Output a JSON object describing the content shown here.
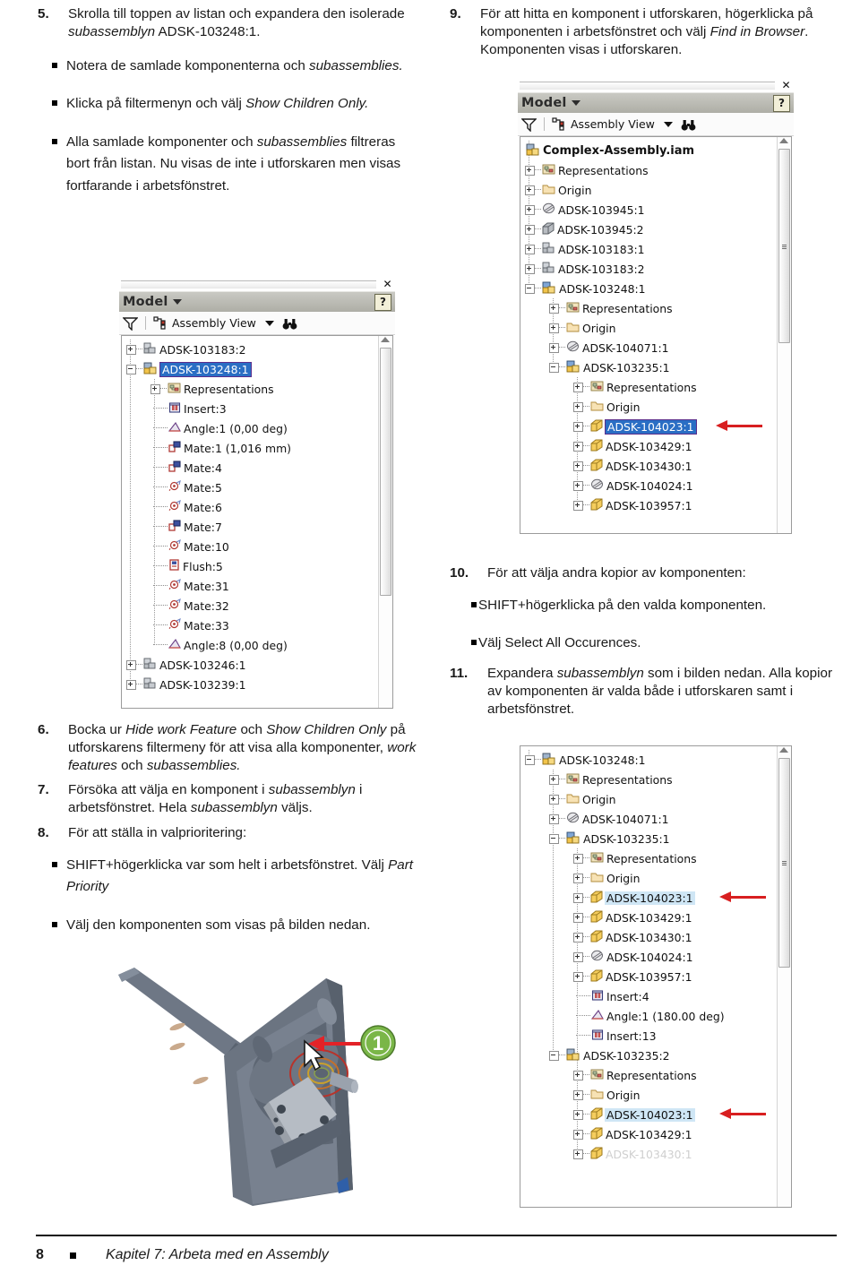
{
  "document": {
    "footer": {
      "page_number": "8",
      "bullet": "square-bullet",
      "text": "Kapitel 7: Arbeta med en Assembly"
    }
  },
  "left_column": {
    "step5": {
      "number": "5.",
      "text_a": "Skrolla till toppen av listan och expandera den isolerade ",
      "text_b": "subassemblyn",
      "text_c": " ADSK-103248:1.",
      "bullets": [
        {
          "a": "Notera de samlade komponenterna och ",
          "b": "subassemblies.",
          "c": ""
        },
        {
          "a": "Klicka på filtermenyn och välj ",
          "b": "Show Children Only.",
          "c": ""
        },
        {
          "a": "Alla samlade komponenter och ",
          "b": "subassemblies",
          "c": " filtreras bort från listan. Nu visas de inte i utforskaren men visas fortfarande i arbetsfönstret."
        }
      ]
    },
    "step6": {
      "number": "6.",
      "t1": "Bocka ur ",
      "i1": "Hide work Feature",
      "t2": " och ",
      "i2": "Show Children Only",
      "t3": " på utforskarens filtermeny för att visa alla komponenter, ",
      "i3": "work features",
      "t4": " och ",
      "i4": "subassemblies."
    },
    "step7": {
      "number": "7.",
      "t1": "Försöka att välja en komponent i ",
      "i1": "subassemblyn",
      "t2": " i arbetsfönstret. Hela ",
      "i2": "subassemblyn",
      "t3": " väljs."
    },
    "step8": {
      "number": "8.",
      "text": "För att ställa in valprioritering:",
      "bullets": [
        {
          "a": "SHIFT+högerklicka var som helt i arbetsfönstret. Välj ",
          "b": "Part Priority",
          "c": ""
        },
        {
          "a": "Välj den komponenten som visas på bilden nedan.",
          "b": "",
          "c": ""
        }
      ]
    },
    "cad_image": {
      "callout_label": "1",
      "callout_color": "#7ab648",
      "arrow_color": "#e32227",
      "alt": "3D CAD assembly view with cursor and callout"
    }
  },
  "right_column": {
    "step9": {
      "number": "9.",
      "t1": "För att hitta en komponent i utforskaren, högerklicka på komponenten i arbetsfönstret och välj ",
      "i1": "Find in Browser",
      "t2": ". Komponenten visas i utforskaren."
    },
    "step10": {
      "number": "10.",
      "text": "För att välja andra kopior av komponenten:",
      "bullets": [
        {
          "a": "SHIFT+högerklicka på den valda komponenten.",
          "b": "",
          "c": ""
        },
        {
          "a": "Välj Select All Occurences.",
          "b": "",
          "c": ""
        }
      ]
    },
    "step11": {
      "number": "11.",
      "t1": "Expandera ",
      "i1": "subassemblyn",
      "t2": " som i bilden nedan. Alla kopior av komponenten är valda både i utforskaren samt i arbetsfönstret."
    }
  },
  "browser_left": {
    "title": "Model",
    "close_icon": "close-icon",
    "help_icon": "help-icon",
    "filter_icon": "filter-icon",
    "view_icon": "assembly-view-icon",
    "view_label": "Assembly View",
    "find_icon": "binoculars-icon",
    "tree": [
      {
        "label": "ADSK-103183:2",
        "indent": 0,
        "toggle": "plus",
        "icon": "part-grey",
        "state": "normal"
      },
      {
        "label": "ADSK-103248:1",
        "indent": 0,
        "toggle": "minus",
        "icon": "assembly-yellow",
        "state": "selected"
      },
      {
        "label": "Representations",
        "indent": 1,
        "toggle": "plus",
        "icon": "representations",
        "state": "normal"
      },
      {
        "label": "Insert:3",
        "indent": 1,
        "toggle": "none",
        "icon": "insert-constraint",
        "state": "normal"
      },
      {
        "label": "Angle:1 (0,00 deg)",
        "indent": 1,
        "toggle": "none",
        "icon": "angle-constraint",
        "state": "normal"
      },
      {
        "label": "Mate:1 (1,016 mm)",
        "indent": 1,
        "toggle": "none",
        "icon": "mate-constraint",
        "state": "normal"
      },
      {
        "label": "Mate:4",
        "indent": 1,
        "toggle": "none",
        "icon": "mate-constraint",
        "state": "normal"
      },
      {
        "label": "Mate:5",
        "indent": 1,
        "toggle": "none",
        "icon": "mate-axis-constraint",
        "state": "normal"
      },
      {
        "label": "Mate:6",
        "indent": 1,
        "toggle": "none",
        "icon": "mate-axis-constraint",
        "state": "normal"
      },
      {
        "label": "Mate:7",
        "indent": 1,
        "toggle": "none",
        "icon": "mate-constraint",
        "state": "normal"
      },
      {
        "label": "Mate:10",
        "indent": 1,
        "toggle": "none",
        "icon": "mate-axis-constraint",
        "state": "normal"
      },
      {
        "label": "Flush:5",
        "indent": 1,
        "toggle": "none",
        "icon": "flush-constraint",
        "state": "normal"
      },
      {
        "label": "Mate:31",
        "indent": 1,
        "toggle": "none",
        "icon": "mate-axis-constraint",
        "state": "normal"
      },
      {
        "label": "Mate:32",
        "indent": 1,
        "toggle": "none",
        "icon": "mate-axis-constraint",
        "state": "normal"
      },
      {
        "label": "Mate:33",
        "indent": 1,
        "toggle": "none",
        "icon": "mate-axis-constraint",
        "state": "normal"
      },
      {
        "label": "Angle:8 (0,00 deg)",
        "indent": 1,
        "toggle": "none",
        "icon": "angle-constraint",
        "state": "normal"
      },
      {
        "label": "ADSK-103246:1",
        "indent": 0,
        "toggle": "plus",
        "icon": "part-grey",
        "state": "normal"
      },
      {
        "label": "ADSK-103239:1",
        "indent": 0,
        "toggle": "plus",
        "icon": "part-grey",
        "state": "normal"
      }
    ]
  },
  "browser_right_top": {
    "title": "Model",
    "close_icon": "close-icon",
    "help_icon": "help-icon",
    "filter_icon": "filter-icon",
    "view_icon": "assembly-view-icon",
    "view_label": "Assembly View",
    "find_icon": "binoculars-icon",
    "tree": [
      {
        "label": "Complex-Assembly.iam",
        "indent": 0,
        "toggle": "none",
        "icon": "assembly-yellow",
        "state": "root"
      },
      {
        "label": "Representations",
        "indent": 0,
        "toggle": "plus",
        "icon": "representations",
        "state": "normal"
      },
      {
        "label": "Origin",
        "indent": 0,
        "toggle": "plus",
        "icon": "folder",
        "state": "normal"
      },
      {
        "label": "ADSK-103945:1",
        "indent": 0,
        "toggle": "plus",
        "icon": "weldment",
        "state": "normal"
      },
      {
        "label": "ADSK-103945:2",
        "indent": 0,
        "toggle": "plus",
        "icon": "box-grey",
        "state": "normal"
      },
      {
        "label": "ADSK-103183:1",
        "indent": 0,
        "toggle": "plus",
        "icon": "part-grey",
        "state": "normal"
      },
      {
        "label": "ADSK-103183:2",
        "indent": 0,
        "toggle": "plus",
        "icon": "part-grey",
        "state": "normal"
      },
      {
        "label": "ADSK-103248:1",
        "indent": 0,
        "toggle": "minus",
        "icon": "assembly-blue",
        "state": "normal"
      },
      {
        "label": "Representations",
        "indent": 1,
        "toggle": "plus",
        "icon": "representations",
        "state": "normal"
      },
      {
        "label": "Origin",
        "indent": 1,
        "toggle": "plus",
        "icon": "folder",
        "state": "normal"
      },
      {
        "label": "ADSK-104071:1",
        "indent": 1,
        "toggle": "plus",
        "icon": "weldment",
        "state": "normal"
      },
      {
        "label": "ADSK-103235:1",
        "indent": 1,
        "toggle": "minus",
        "icon": "assembly-blue",
        "state": "normal"
      },
      {
        "label": "Representations",
        "indent": 2,
        "toggle": "plus",
        "icon": "representations",
        "state": "normal"
      },
      {
        "label": "Origin",
        "indent": 2,
        "toggle": "plus",
        "icon": "folder",
        "state": "normal"
      },
      {
        "label": "ADSK-104023:1",
        "indent": 2,
        "toggle": "plus",
        "icon": "box-yellow",
        "state": "selected"
      },
      {
        "label": "ADSK-103429:1",
        "indent": 2,
        "toggle": "plus",
        "icon": "box-yellow",
        "state": "normal"
      },
      {
        "label": "ADSK-103430:1",
        "indent": 2,
        "toggle": "plus",
        "icon": "box-yellow",
        "state": "normal"
      },
      {
        "label": "ADSK-104024:1",
        "indent": 2,
        "toggle": "plus",
        "icon": "weldment",
        "state": "normal"
      },
      {
        "label": "ADSK-103957:1",
        "indent": 2,
        "toggle": "plus",
        "icon": "box-yellow",
        "state": "normal"
      }
    ]
  },
  "browser_right_bottom": {
    "tree": [
      {
        "label": "ADSK-103248:1",
        "indent": 0,
        "toggle": "minus",
        "icon": "assembly-yellow",
        "state": "normal"
      },
      {
        "label": "Representations",
        "indent": 1,
        "toggle": "plus",
        "icon": "representations",
        "state": "normal"
      },
      {
        "label": "Origin",
        "indent": 1,
        "toggle": "plus",
        "icon": "folder",
        "state": "normal"
      },
      {
        "label": "ADSK-104071:1",
        "indent": 1,
        "toggle": "plus",
        "icon": "weldment",
        "state": "normal"
      },
      {
        "label": "ADSK-103235:1",
        "indent": 1,
        "toggle": "minus",
        "icon": "assembly-blue",
        "state": "normal"
      },
      {
        "label": "Representations",
        "indent": 2,
        "toggle": "plus",
        "icon": "representations",
        "state": "normal"
      },
      {
        "label": "Origin",
        "indent": 2,
        "toggle": "plus",
        "icon": "folder",
        "state": "normal"
      },
      {
        "label": "ADSK-104023:1",
        "indent": 2,
        "toggle": "plus",
        "icon": "box-yellow",
        "state": "highlighted"
      },
      {
        "label": "ADSK-103429:1",
        "indent": 2,
        "toggle": "plus",
        "icon": "box-yellow",
        "state": "normal"
      },
      {
        "label": "ADSK-103430:1",
        "indent": 2,
        "toggle": "plus",
        "icon": "box-yellow",
        "state": "normal"
      },
      {
        "label": "ADSK-104024:1",
        "indent": 2,
        "toggle": "plus",
        "icon": "weldment",
        "state": "normal"
      },
      {
        "label": "ADSK-103957:1",
        "indent": 2,
        "toggle": "plus",
        "icon": "box-yellow",
        "state": "normal"
      },
      {
        "label": "Insert:4",
        "indent": 2,
        "toggle": "none",
        "icon": "insert-constraint",
        "state": "normal"
      },
      {
        "label": "Angle:1 (180.00 deg)",
        "indent": 2,
        "toggle": "none",
        "icon": "angle-constraint",
        "state": "normal"
      },
      {
        "label": "Insert:13",
        "indent": 2,
        "toggle": "none",
        "icon": "insert-constraint",
        "state": "normal"
      },
      {
        "label": "ADSK-103235:2",
        "indent": 1,
        "toggle": "minus",
        "icon": "assembly-yellow",
        "state": "normal"
      },
      {
        "label": "Representations",
        "indent": 2,
        "toggle": "plus",
        "icon": "representations",
        "state": "normal"
      },
      {
        "label": "Origin",
        "indent": 2,
        "toggle": "plus",
        "icon": "folder",
        "state": "normal"
      },
      {
        "label": "ADSK-104023:1",
        "indent": 2,
        "toggle": "plus",
        "icon": "box-yellow",
        "state": "highlighted"
      },
      {
        "label": "ADSK-103429:1",
        "indent": 2,
        "toggle": "plus",
        "icon": "box-yellow",
        "state": "normal"
      },
      {
        "label": "ADSK-103430:1",
        "indent": 2,
        "toggle": "plus",
        "icon": "box-yellow",
        "state": "faded"
      }
    ]
  }
}
